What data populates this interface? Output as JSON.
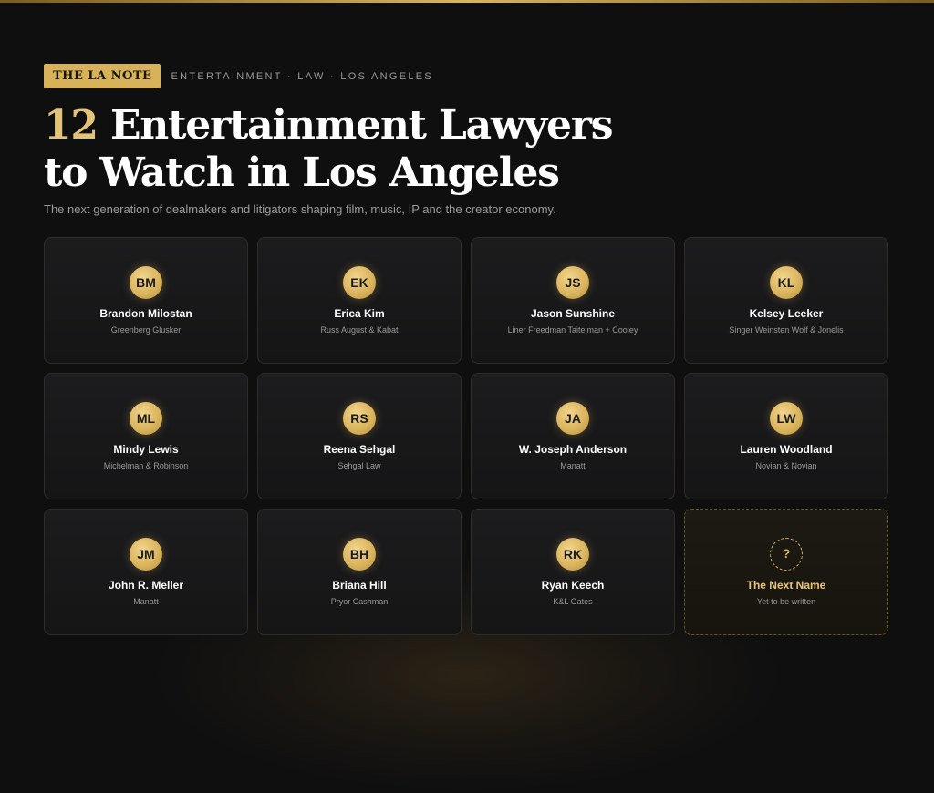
{
  "header": {
    "badge": "THE LA NOTE",
    "section": "ENTERTAINMENT · LAW · LOS ANGELES",
    "title_number": "12",
    "title_line1_rest": "Entertainment Lawyers",
    "title_line2": "to Watch in Los Angeles",
    "subtitle": "The next generation of dealmakers and litigators shaping film, music, IP and the creator economy."
  },
  "colors": {
    "background": "#0f0f10",
    "gold_accent": "#d7b258",
    "card_background": "#1a1a1c"
  },
  "lawyers": [
    {
      "initials": "BM",
      "name": "Brandon Milostan",
      "firm": "Greenberg Glusker"
    },
    {
      "initials": "EK",
      "name": "Erica Kim",
      "firm": "Russ August & Kabat"
    },
    {
      "initials": "JS",
      "name": "Jason Sunshine",
      "firm": "Liner Freedman Taitelman + Cooley"
    },
    {
      "initials": "KL",
      "name": "Kelsey Leeker",
      "firm": "Singer Weinsten Wolf & Jonelis"
    },
    {
      "initials": "ML",
      "name": "Mindy Lewis",
      "firm": "Michelman & Robinson"
    },
    {
      "initials": "RS",
      "name": "Reena Sehgal",
      "firm": "Sehgal Law"
    },
    {
      "initials": "JA",
      "name": "W. Joseph Anderson",
      "firm": "Manatt"
    },
    {
      "initials": "LW",
      "name": "Lauren Woodland",
      "firm": "Novian & Novian"
    },
    {
      "initials": "JM",
      "name": "John R. Meller",
      "firm": "Manatt"
    },
    {
      "initials": "BH",
      "name": "Briana Hill",
      "firm": "Pryor Cashman"
    },
    {
      "initials": "RK",
      "name": "Ryan Keech",
      "firm": "K&L Gates"
    }
  ],
  "next_card": {
    "symbol": "?",
    "title": "The Next Name",
    "subtitle": "Yet to be written"
  }
}
